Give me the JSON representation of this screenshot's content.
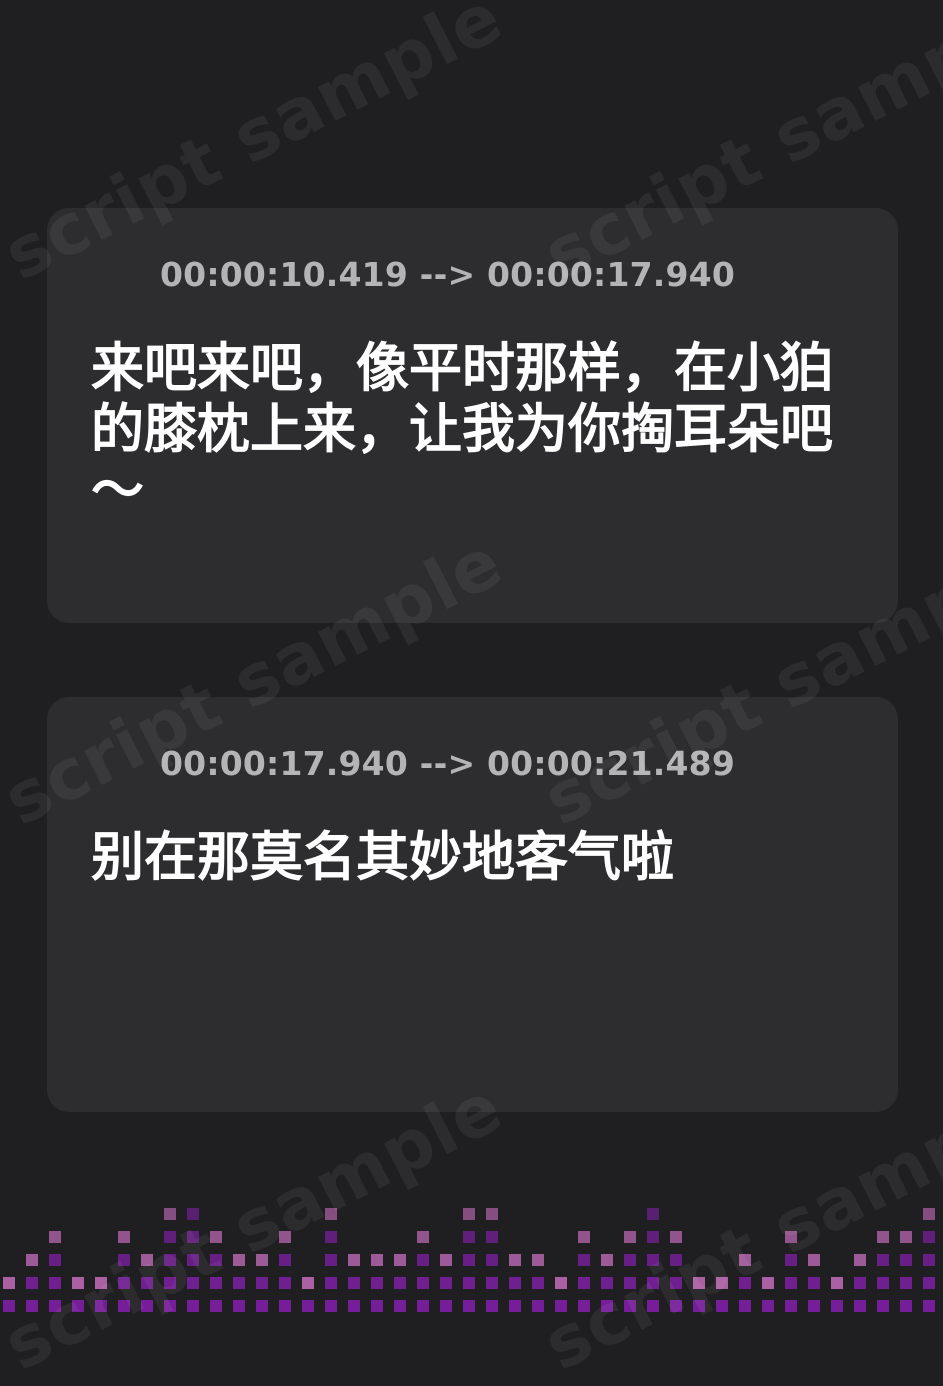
{
  "watermark": {
    "text": "script sample"
  },
  "colors": {
    "background": "#1f1f21",
    "card": "#2d2d2f",
    "timecode": "#b4b4b6",
    "subtitle": "#ffffff",
    "accent_pink": "#e05ed8",
    "accent_purple": "#9b3fb8",
    "equalizer_dark": "#7b1fa0",
    "equalizer_light": "#c06ab8"
  },
  "entries": [
    {
      "icon": "audio-wave-icon",
      "timecode": "00:00:10.419 --> 00:00:17.940",
      "text": "来吧来吧，像平时那样，在小狛的膝枕上来，让我为你掏耳朵吧～"
    },
    {
      "icon": "audio-wave-icon",
      "timecode": "00:00:17.940 --> 00:00:21.489",
      "text": "别在那莫名其妙地客气啦"
    }
  ],
  "equalizer": {
    "icon": "equalizer-bars",
    "levels": [
      2,
      3,
      4,
      2,
      2,
      4,
      3,
      5,
      6,
      4,
      3,
      3,
      4,
      2,
      5,
      3,
      3,
      3,
      4,
      3,
      5,
      5,
      3,
      3,
      2,
      4,
      3,
      4,
      6,
      4,
      2,
      2,
      3,
      2,
      4,
      3,
      2,
      3,
      4,
      4,
      5,
      6,
      5,
      3,
      3,
      2,
      4,
      3,
      2,
      4,
      3,
      3,
      1,
      2,
      3,
      4,
      3,
      4,
      4,
      5,
      6,
      2,
      2,
      4,
      3,
      3,
      5,
      4,
      4,
      2,
      2,
      3,
      3,
      3,
      3,
      3,
      4,
      3,
      4,
      5,
      6,
      5,
      2,
      2,
      3,
      4,
      3,
      2,
      2,
      3,
      3,
      3,
      2,
      2,
      3,
      4,
      3,
      4,
      5,
      6,
      4,
      3,
      3,
      4,
      3,
      2,
      2,
      3,
      4,
      3
    ]
  }
}
